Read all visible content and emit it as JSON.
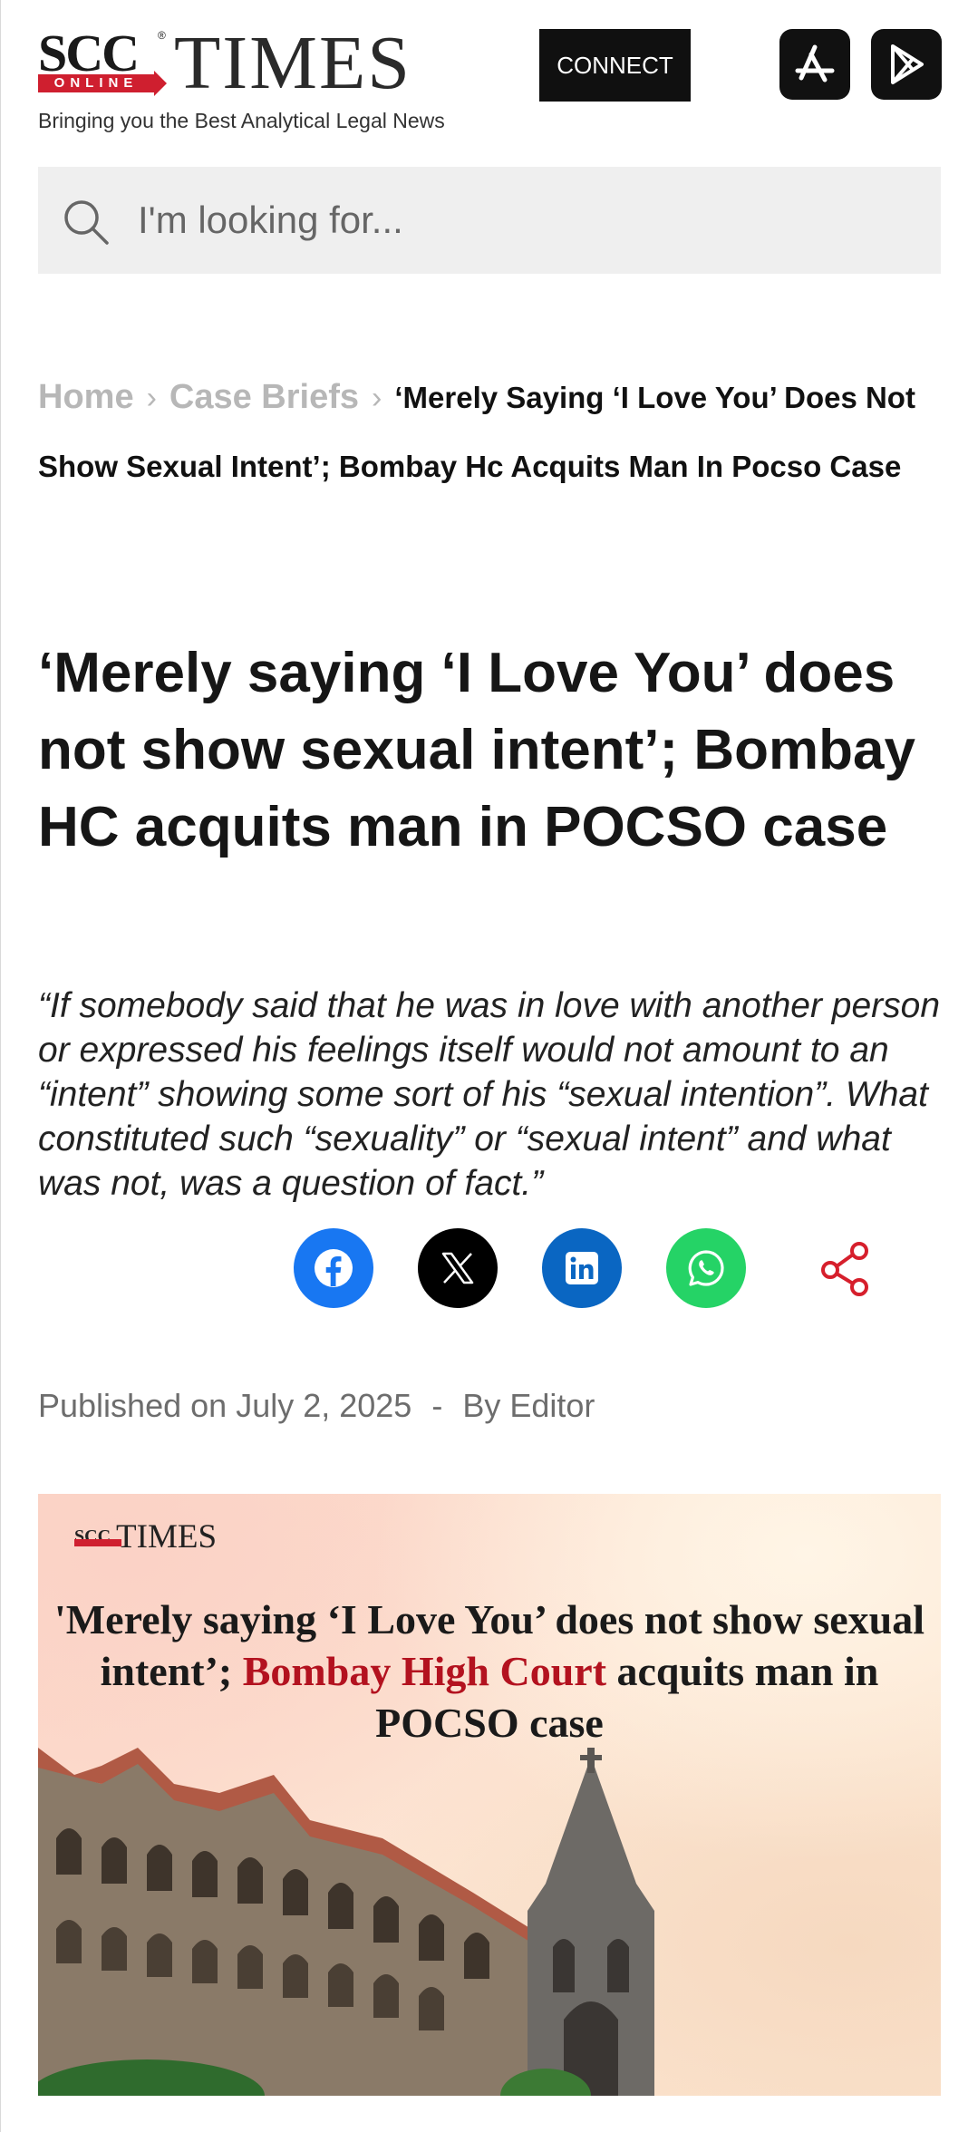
{
  "header": {
    "logo_scc": "SCC",
    "logo_online": "ONLINE",
    "logo_times": "TIMES",
    "tagline": "Bringing you the Best Analytical Legal News",
    "connect_label": "CONNECT",
    "app_store_icon": "app-store-icon",
    "play_store_icon": "play-store-icon"
  },
  "search": {
    "placeholder": "I'm looking for...",
    "value": ""
  },
  "breadcrumb": {
    "home": "Home",
    "section": "Case Briefs",
    "current": "‘Merely Saying ‘I Love You’ Does Not Show Sexual Intent’; Bombay Hc Acquits Man In Pocso Case"
  },
  "article": {
    "title": "‘Merely saying ‘I Love You’ does not show sexual intent’; Bombay HC acquits man in POCSO case",
    "excerpt": "“If somebody said that he was in love with another person or expressed his feelings itself would not amount to an “intent” showing some sort of his “sexual intention”. What constituted such “sexuality” or “sexual intent” and what was not, was a question of fact.”",
    "published_prefix": "Published on",
    "published_date": "July 2, 2025",
    "separator": "-",
    "author": "By Editor"
  },
  "share": {
    "icons": [
      "facebook-icon",
      "x-icon",
      "linkedin-icon",
      "whatsapp-icon",
      "share-icon"
    ],
    "colors": {
      "facebook": "#1877f2",
      "x": "#000000",
      "linkedin": "#0a66c2",
      "whatsapp": "#25d366",
      "share": "#d61f2c"
    }
  },
  "hero": {
    "logo_scc": "SCC",
    "logo_times": "TIMES",
    "headline_part1": "'Merely saying ‘I Love You’ does not show sexual intent’;",
    "headline_highlight": "Bombay High Court",
    "headline_part2": "acquits man in POCSO case"
  },
  "colors": {
    "brand_red": "#cf1f2f",
    "breadcrumb_link": "#b7b7b7",
    "search_bg": "#efefef"
  }
}
